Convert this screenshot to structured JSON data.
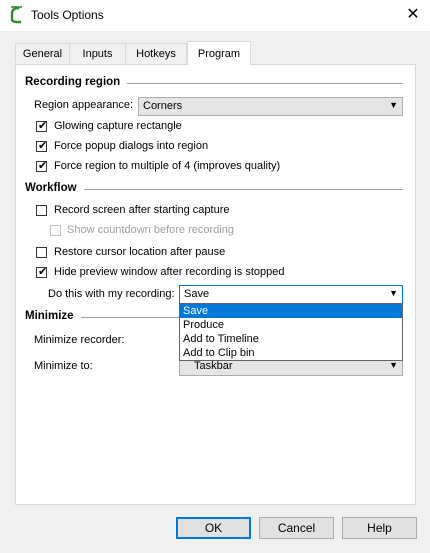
{
  "window": {
    "title": "Tools Options",
    "close_icon": "close-icon"
  },
  "tabs": [
    {
      "label": "General"
    },
    {
      "label": "Inputs"
    },
    {
      "label": "Hotkeys"
    },
    {
      "label": "Program",
      "active": true
    }
  ],
  "recording_region": {
    "heading": "Recording region",
    "appearance_label": "Region appearance:",
    "appearance_value": "Corners",
    "options": [
      {
        "label": "Glowing capture rectangle",
        "checked": true
      },
      {
        "label": "Force popup dialogs into region",
        "checked": true
      },
      {
        "label": "Force region to multiple of 4 (improves quality)",
        "checked": true
      }
    ]
  },
  "workflow": {
    "heading": "Workflow",
    "options": [
      {
        "label": "Record screen after starting capture",
        "checked": false
      },
      {
        "label": "Show countdown before recording",
        "checked": false,
        "disabled": true
      },
      {
        "label": "Restore cursor location after pause",
        "checked": false
      },
      {
        "label": "Hide preview window after recording is stopped",
        "checked": true
      }
    ],
    "do_this_label": "Do this with my recording:",
    "do_this_value": "Save",
    "dropdown_options": [
      "Save",
      "Produce",
      "Add to Timeline",
      "Add to Clip bin"
    ]
  },
  "minimize": {
    "heading": "Minimize",
    "recorder_label": "Minimize recorder:",
    "to_label": "Minimize to:",
    "to_value": "Taskbar"
  },
  "buttons": {
    "ok": "OK",
    "cancel": "Cancel",
    "help": "Help"
  },
  "colors": {
    "accent": "#0078d7",
    "checkmark_icon": "check-icon"
  }
}
